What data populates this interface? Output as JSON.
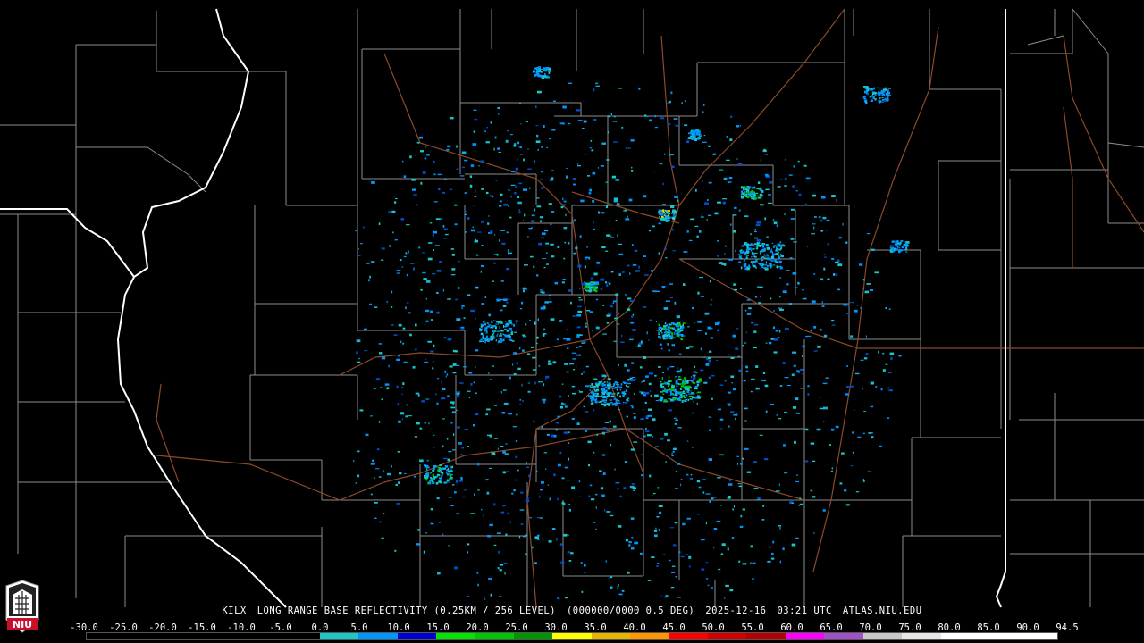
{
  "caption": {
    "station": "KILX",
    "product": "LONG RANGE BASE REFLECTIVITY (0.25KM / 256 LEVEL)",
    "volume": "(000000/0000 0.5 DEG)",
    "date": "2025-12-16",
    "time": "03:21 UTC",
    "source": "ATLAS.NIU.EDU"
  },
  "logo": {
    "text": "NIU"
  },
  "scale": {
    "labels": [
      "-30.0",
      "-25.0",
      "-20.0",
      "-15.0",
      "-10.0",
      "-5.0",
      "0.0",
      "5.0",
      "10.0",
      "15.0",
      "20.0",
      "25.0",
      "30.0",
      "35.0",
      "40.0",
      "45.0",
      "50.0",
      "55.0",
      "60.0",
      "65.0",
      "70.0",
      "75.0",
      "80.0",
      "85.0",
      "90.0",
      "94.5"
    ],
    "colors": [
      "#000000",
      "#000000",
      "#000000",
      "#000000",
      "#000000",
      "#000000",
      "#19c8c8",
      "#0096ff",
      "#0000d2",
      "#00e600",
      "#00c800",
      "#009600",
      "#ffff00",
      "#e6b400",
      "#ff9600",
      "#ff0000",
      "#d20000",
      "#b40000",
      "#ff00ff",
      "#a050c8",
      "#c8c8c8",
      "#e6e6e6",
      "#ffffff",
      "#ffffff",
      "#ffffff"
    ]
  },
  "map_colors": {
    "state_border": "#ffffff",
    "county_border": "#a0a0a0",
    "highway": "#8b4a2a",
    "background": "#000000"
  }
}
